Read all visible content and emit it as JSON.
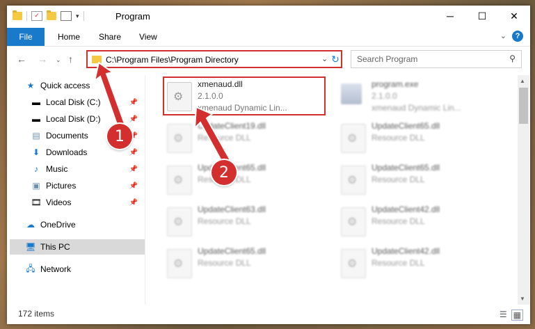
{
  "window": {
    "title": "Program",
    "controls": {
      "minimize": "─",
      "maximize": "☐",
      "close": "✕"
    }
  },
  "ribbon": {
    "tabs": [
      "File",
      "Home",
      "Share",
      "View"
    ],
    "help": "?"
  },
  "address": {
    "path": "C:\\Program Files\\Program Directory",
    "refresh_icon": "refresh-icon"
  },
  "search": {
    "placeholder": "Search Program"
  },
  "nav": {
    "items": [
      {
        "label": "Quick access",
        "icon": "star-icon"
      },
      {
        "label": "Local Disk (C:)",
        "icon": "drive-icon"
      },
      {
        "label": "Local Disk (D:)",
        "icon": "drive-icon"
      },
      {
        "label": "Documents",
        "icon": "documents-icon"
      },
      {
        "label": "Downloads",
        "icon": "download-icon"
      },
      {
        "label": "Music",
        "icon": "music-icon"
      },
      {
        "label": "Pictures",
        "icon": "pictures-icon"
      },
      {
        "label": "Videos",
        "icon": "videos-icon"
      },
      {
        "label": "OneDrive",
        "icon": "cloud-icon"
      },
      {
        "label": "This PC",
        "icon": "computer-icon"
      },
      {
        "label": "Network",
        "icon": "network-icon"
      }
    ]
  },
  "files": [
    {
      "name": "xmenaud.dll",
      "line2": "2.1.0.0",
      "line3": "xmenaud Dynamic Lin..."
    },
    {
      "name": "program.exe",
      "line2": "2.1.0.0",
      "line3": "xmenaud Dynamic Lin..."
    },
    {
      "name": "UpdateClient19.dll",
      "line2": "Resource DLL"
    },
    {
      "name": "UpdateClient65.dll",
      "line2": "Resource DLL"
    },
    {
      "name": "UpdateClient65.dll",
      "line2": "Resource DLL"
    },
    {
      "name": "UpdateClient65.dll",
      "line2": "Resource DLL"
    },
    {
      "name": "UpdateClient63.dll",
      "line2": "Resource DLL"
    },
    {
      "name": "UpdateClient42.dll",
      "line2": "Resource DLL"
    },
    {
      "name": "UpdateClient65.dll",
      "line2": "Resource DLL"
    },
    {
      "name": "UpdateClient42.dll",
      "line2": "Resource DLL"
    }
  ],
  "status": {
    "count": "172 items"
  },
  "annotations": {
    "badge1": "1",
    "badge2": "2"
  },
  "colors": {
    "accent": "#1979ca",
    "highlight": "#d32f2f"
  }
}
